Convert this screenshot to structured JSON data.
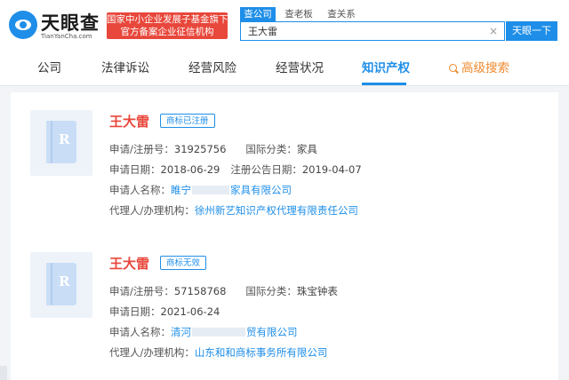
{
  "header": {
    "logo_text": "天眼查",
    "logo_domain": "TianYanCha.com",
    "gov_badge_line1": "国家中小企业发展子基金旗下",
    "gov_badge_line2": "官方备案企业征信机构",
    "search_tabs": [
      "查公司",
      "查老板",
      "查关系"
    ],
    "search_value": "王大雷",
    "clear_symbol": "×",
    "search_button": "天眼一下"
  },
  "nav": {
    "items": [
      "公司",
      "法律诉讼",
      "经营风险",
      "经营状况",
      "知识产权"
    ],
    "active": "知识产权",
    "advanced": "高级搜索"
  },
  "trademarks": [
    {
      "title": "王大雷",
      "status": "商标已注册",
      "reg_label": "申请/注册号：",
      "reg_no": "31925756",
      "class_label": "国际分类：",
      "class_value": "家具",
      "date_label": "申请日期：",
      "date_value": "2018-06-29",
      "announce_label": "注册公告日期：",
      "announce_value": "2019-04-07",
      "applicant_label": "申请人名称：",
      "applicant_prefix": "睢宁",
      "applicant_suffix": "家具有限公司",
      "agent_label": "代理人/办理机构：",
      "agent_value": "徐州新艺知识产权代理有限责任公司"
    },
    {
      "title": "王大雷",
      "status": "商标无效",
      "reg_label": "申请/注册号：",
      "reg_no": "57158768",
      "class_label": "国际分类：",
      "class_value": "珠宝钟表",
      "date_label": "申请日期：",
      "date_value": "2021-06-24",
      "applicant_label": "申请人名称：",
      "applicant_prefix": "清河",
      "applicant_suffix": "贸有限公司",
      "agent_label": "代理人/办理机构：",
      "agent_value": "山东和和商标事务所有限公司"
    }
  ]
}
